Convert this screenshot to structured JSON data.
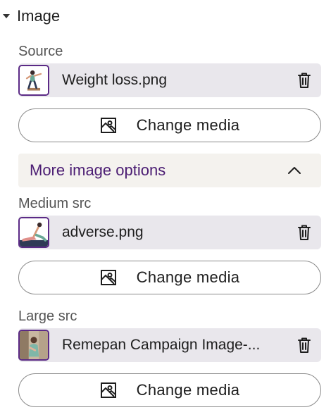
{
  "section": {
    "title": "Image",
    "expanded": true
  },
  "source": {
    "label": "Source",
    "filename": "Weight loss.png",
    "thumbnail_icon": "person-exercising-thumbnail",
    "change_label": "Change media"
  },
  "more_options": {
    "label": "More image options",
    "expanded": true
  },
  "medium": {
    "label": "Medium src",
    "filename": "adverse.png",
    "thumbnail_icon": "person-stretching-thumbnail",
    "change_label": "Change media"
  },
  "large": {
    "label": "Large src",
    "filename": "Remepan Campaign Image-...",
    "thumbnail_icon": "campaign-photo-thumbnail",
    "change_label": "Change media"
  },
  "colors": {
    "accent": "#5b2a86",
    "more_options_text": "#4b1d73",
    "media_row_bg": "#e9e7ec",
    "more_options_bg": "#f4f2ee"
  },
  "icons": {
    "delete": "trash-icon",
    "change_media": "image-media-icon",
    "section_toggle": "caret-down-icon",
    "more_toggle": "chevron-up-icon"
  }
}
